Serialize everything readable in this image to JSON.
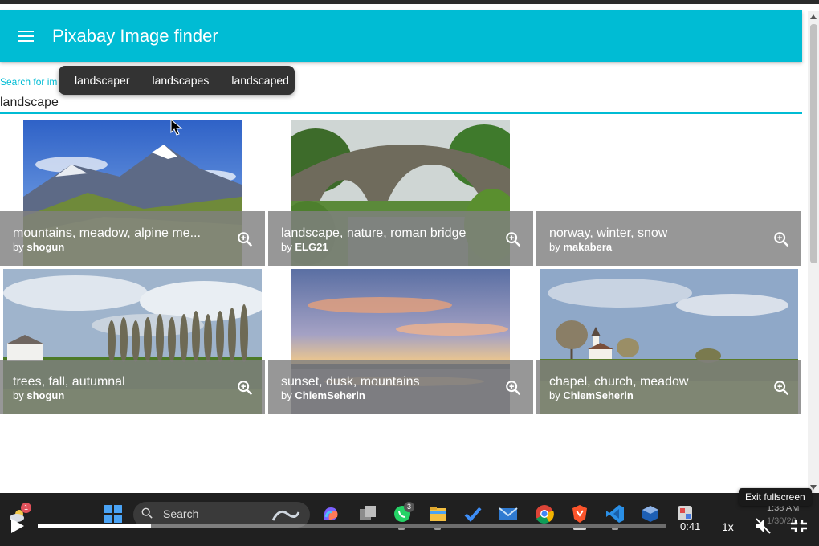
{
  "app": {
    "title": "Pixabay Image finder"
  },
  "search": {
    "label": "Search for im",
    "value": "landscape"
  },
  "suggestions": [
    "landscaper",
    "landscapes",
    "landscaped"
  ],
  "images": [
    {
      "title": "mountains, meadow, alpine me...",
      "author": "shogun"
    },
    {
      "title": "landscape, nature, roman bridge",
      "author": "ELG21"
    },
    {
      "title": "norway, winter, snow",
      "author": "makabera"
    },
    {
      "title": "trees, fall, autumnal",
      "author": "shogun"
    },
    {
      "title": "sunset, dusk, mountains",
      "author": "ChiemSeherin"
    },
    {
      "title": "chapel, church, meadow",
      "author": "ChiemSeherin"
    }
  ],
  "by_prefix": "by",
  "taskbar": {
    "search_placeholder": "Search",
    "weather_badge": "1",
    "whatsapp_badge": "3",
    "clock_time": "1:38 AM",
    "clock_date": "1/30/20..."
  },
  "player": {
    "time": "0:41",
    "speed": "1x",
    "tooltip": "Exit fullscreen",
    "progress": 0.18
  },
  "colors": {
    "accent": "#00bcd4",
    "overlay": "#808080"
  }
}
